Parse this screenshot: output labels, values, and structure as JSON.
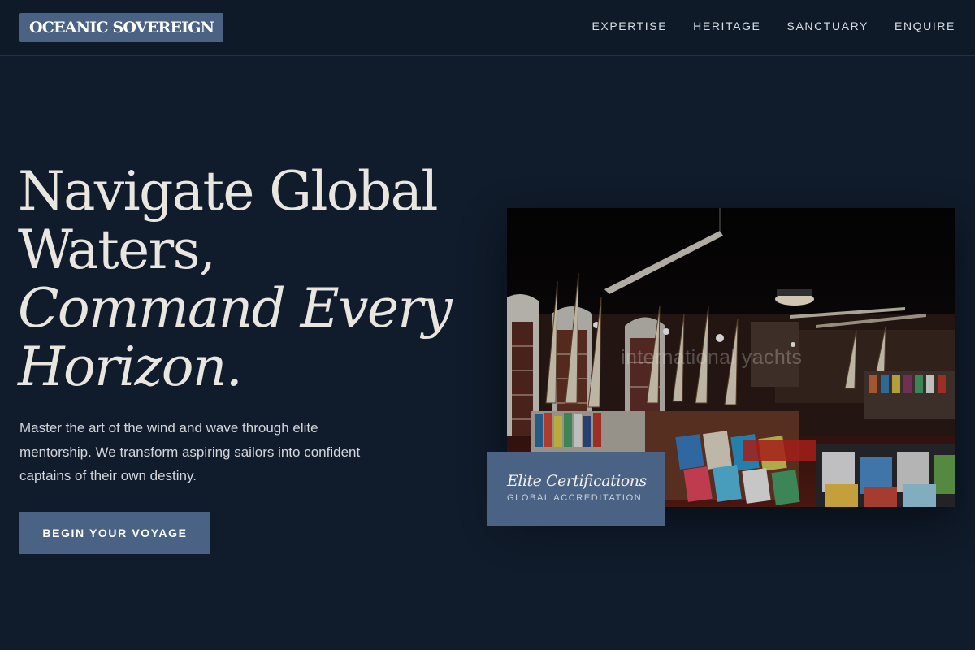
{
  "brand": {
    "name": "OCEANIC SOVEREIGN"
  },
  "nav": {
    "items": [
      {
        "label": "EXPERTISE"
      },
      {
        "label": "HERITAGE"
      },
      {
        "label": "SANCTUARY"
      },
      {
        "label": "ENQUIRE"
      }
    ]
  },
  "hero": {
    "title_line1": "Navigate Global",
    "title_line2": "Waters,",
    "title_line3": "Command Every",
    "title_line4": "Horizon.",
    "description": "Master the art of the wind and wave through elite mentorship. We transform aspiring sailors into confident captains of their own destiny.",
    "cta_label": "BEGIN YOUR VOYAGE"
  },
  "image": {
    "watermark": "international yachts"
  },
  "badge": {
    "title": "Elite Certifications",
    "subtitle": "GLOBAL ACCREDITATION"
  },
  "colors": {
    "background": "#101b2b",
    "accent": "#4a6384",
    "text": "#e9e6df"
  }
}
